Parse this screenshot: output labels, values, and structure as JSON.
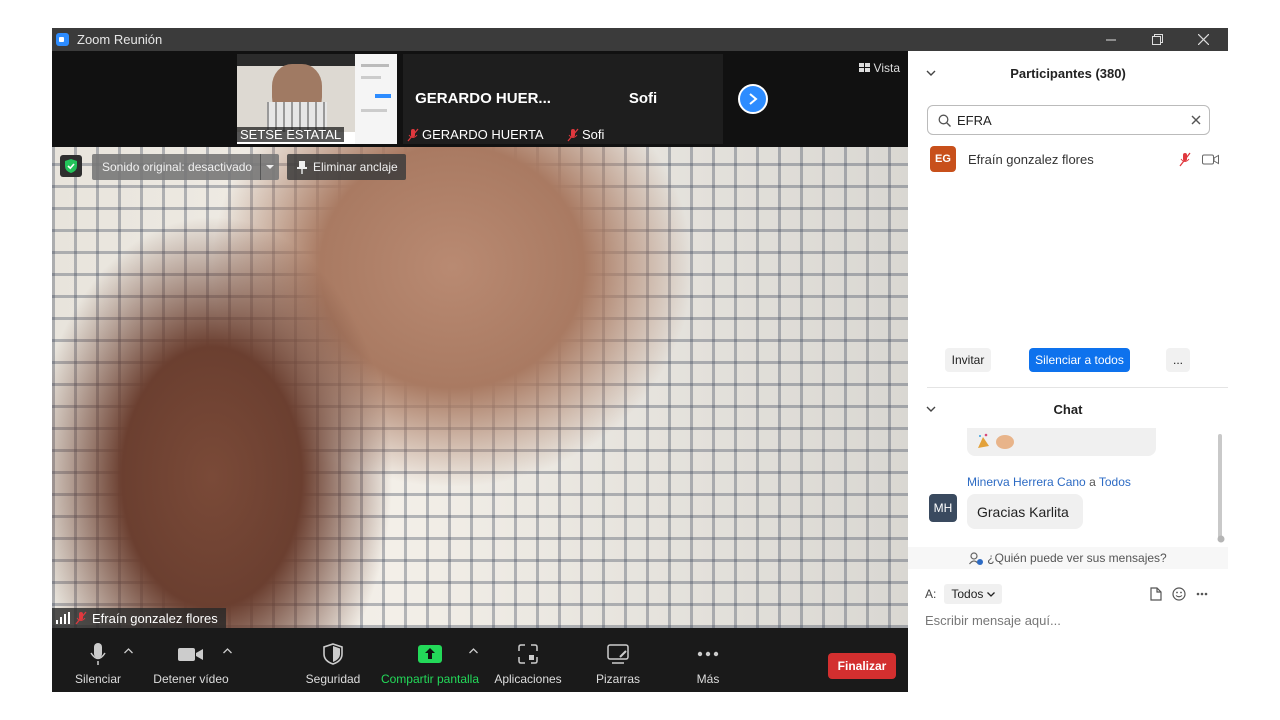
{
  "window": {
    "title": "Zoom Reunión"
  },
  "thumbnails": [
    {
      "name": "SETSE ESTATAL",
      "muted": false,
      "type": "screen"
    },
    {
      "name": "GERARDO HUERTA",
      "display_name": "GERARDO HUER...",
      "muted": true
    },
    {
      "name": "Sofi",
      "display_name": "Sofi",
      "muted": true
    }
  ],
  "view_label": "Vista",
  "video": {
    "original_sound": "Sonido original: desactivado",
    "unpin": "Eliminar anclaje",
    "speaker": "Efraín gonzalez flores"
  },
  "toolbar": {
    "mute": "Silenciar",
    "stop_video": "Detener vídeo",
    "security": "Seguridad",
    "share": "Compartir pantalla",
    "apps": "Aplicaciones",
    "whiteboards": "Pizarras",
    "more": "Más",
    "end": "Finalizar"
  },
  "participants": {
    "title": "Participantes (380)",
    "search_value": "EFRA",
    "list": [
      {
        "initials": "EG",
        "name": "Efraín gonzalez flores"
      }
    ],
    "invite": "Invitar",
    "mute_all": "Silenciar a todos",
    "more": "..."
  },
  "chat": {
    "title": "Chat",
    "messages": [
      {
        "sender": "Minerva Herrera Cano",
        "to_word": "a",
        "to": "Todos",
        "initials": "MH",
        "text": "Gracias Karlita"
      }
    ],
    "who_can_see": "¿Quién puede ver sus mensajes?",
    "to_label": "A:",
    "to_value": "Todos",
    "placeholder": "Escribir mensaje aquí..."
  },
  "colors": {
    "accent": "#0e72ed",
    "end": "#d32f2f",
    "share": "#23d959",
    "avatar_eg": "#c8501b"
  }
}
